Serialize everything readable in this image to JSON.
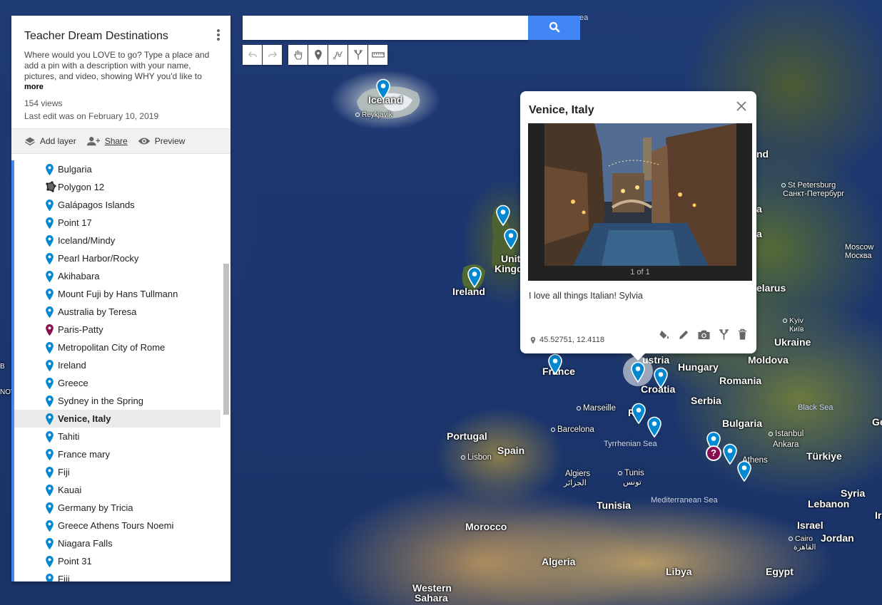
{
  "search": {
    "value": "",
    "placeholder": ""
  },
  "toolbar": {
    "tools": [
      "undo-icon",
      "redo-icon",
      "hand-icon",
      "marker-icon",
      "draw-line-icon",
      "directions-icon",
      "ruler-icon"
    ]
  },
  "panel": {
    "title": "Teacher Dream Destinations",
    "description": "Where would you LOVE to go?  Type a place and add a pin with a description with your name, pictures, and video, showing WHY you'd like to",
    "more": "more",
    "views": "154 views",
    "last_edit": "Last edit was on February 10, 2019",
    "actions": {
      "add_layer": "Add layer",
      "share": "Share",
      "preview": "Preview"
    },
    "items": [
      {
        "label": "Bulgaria",
        "icon": "blue-pin"
      },
      {
        "label": "Polygon 12",
        "icon": "polygon"
      },
      {
        "label": "Galápagos Islands",
        "icon": "blue-pin"
      },
      {
        "label": "Point 17",
        "icon": "blue-pin"
      },
      {
        "label": "Iceland/Mindy",
        "icon": "blue-pin"
      },
      {
        "label": "Pearl Harbor/Rocky",
        "icon": "blue-pin"
      },
      {
        "label": "Akihabara",
        "icon": "blue-pin"
      },
      {
        "label": "Mount Fuji by Hans Tullmann",
        "icon": "blue-pin"
      },
      {
        "label": "Australia by Teresa",
        "icon": "blue-pin"
      },
      {
        "label": "Paris-Patty",
        "icon": "maroon-pin"
      },
      {
        "label": "Metropolitan City of Rome",
        "icon": "blue-pin"
      },
      {
        "label": "Ireland",
        "icon": "blue-pin"
      },
      {
        "label": "Greece",
        "icon": "blue-pin"
      },
      {
        "label": "Sydney in the Spring",
        "icon": "blue-pin"
      },
      {
        "label": "Venice, Italy",
        "icon": "blue-pin",
        "selected": true
      },
      {
        "label": "Tahiti",
        "icon": "blue-pin"
      },
      {
        "label": "France mary",
        "icon": "blue-pin"
      },
      {
        "label": "Fiji",
        "icon": "blue-pin"
      },
      {
        "label": "Kauai",
        "icon": "blue-pin"
      },
      {
        "label": "Germany by Tricia",
        "icon": "blue-pin"
      },
      {
        "label": "Greece Athens Tours Noemi",
        "icon": "blue-pin"
      },
      {
        "label": "Niagara Falls",
        "icon": "blue-pin"
      },
      {
        "label": "Point 31",
        "icon": "blue-pin"
      },
      {
        "label": "Fiji",
        "icon": "blue-pin"
      }
    ]
  },
  "card": {
    "title": "Venice, Italy",
    "photo_count": "1 of 1",
    "description": "I love all things Italian!   Sylvia",
    "coords": "45.52751, 12.4118"
  },
  "map_labels": {
    "iceland": "Iceland",
    "reykjavik": "Reykjavik",
    "unit": "Unit",
    "kingd": "Kingd",
    "ireland": "Ireland",
    "france": "France",
    "austria": "ustria",
    "hungary": "Hungary",
    "croatia": "Croatia",
    "serbia": "Serbia",
    "romania": "Romania",
    "moldova": "Moldova",
    "ukraine": "Ukraine",
    "kyiv": "Kyiv",
    "kyiv_cyr": "Київ",
    "st_petersburg": "St Petersburg",
    "st_petersburg_cyr": "Санкт-Петербург",
    "moscow": "Moscow",
    "moscow_cyr": "Москва",
    "belarus": "elarus",
    "nd": "nd",
    "a1": "a",
    "a2": "a",
    "bulgaria": "Bulgaria",
    "black_sea": "Black Sea",
    "istanbul": "Istanbul",
    "ankara": "Ankara",
    "turkiye": "Türkiye",
    "portugal": "Portugal",
    "lisbon": "Lisbon",
    "spain": "Spain",
    "marseille": "Marseille",
    "barcelona": "Barcelona",
    "tyrrhenian": "Tyrrhenian Sea",
    "algiers": "Algiers",
    "algiers_ar": "الجزائر",
    "tunis": "Tunis",
    "tunis_ar": "تونس",
    "tunisia": "Tunisia",
    "med_sea": "Mediterranean Sea",
    "athens": "Athens",
    "syria": "Syria",
    "lebanon": "Lebanon",
    "israel": "Israel",
    "jordan": "Jordan",
    "cairo": "Cairo",
    "cairo_ar": "القاهرة",
    "morocco": "Morocco",
    "algeria": "Algeria",
    "libya": "Libya",
    "egypt": "Egypt",
    "western": "Western",
    "sahara": "Sahara",
    "rome_partial": "R",
    "rome_e": "e",
    "ge": "Ge",
    "ir": "Ir",
    "sea_top": "ea",
    "left_b": "B",
    "left_nov": "NOV"
  }
}
